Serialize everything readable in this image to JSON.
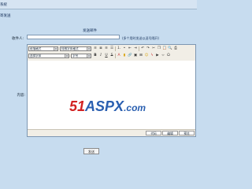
{
  "window": {
    "title": "系統"
  },
  "section": {
    "title": "寄发送"
  },
  "page": {
    "heading": "发送邮件"
  },
  "form": {
    "recipient_label": "收件人:",
    "recipient_value": "",
    "recipient_hint": "(多个用时发送以逗号隔开)",
    "content_label": "内容:"
  },
  "editor": {
    "toolbar": {
      "paragraph_format": "段落格式",
      "special_font": "特殊字体格式",
      "font_family": "选择字体",
      "font_size": "字号",
      "row1_icons": [
        "align-left-icon",
        "align-center-icon",
        "align-right-icon",
        "justify-icon",
        "numbered-list-icon",
        "bullet-list-icon",
        "outdent-icon",
        "indent-icon",
        "undo-icon",
        "redo-icon",
        "cut-icon",
        "copy-icon",
        "paste-icon",
        "find-icon",
        "print-icon"
      ],
      "row2_icons": [
        "bold-icon",
        "italic-icon",
        "underline-icon",
        "strikethrough-icon",
        "font-color-icon",
        "highlight-icon",
        "link-icon",
        "image-icon",
        "table-icon",
        "emoticon-icon",
        "flash-icon",
        "media-icon",
        "code-icon",
        "symbol-icon"
      ]
    },
    "watermark": {
      "num": "51",
      "word": "ASPX",
      "domain": ".com"
    },
    "tabs": [
      "代码",
      "编辑",
      "预览"
    ]
  },
  "actions": {
    "send_label": "发送"
  }
}
